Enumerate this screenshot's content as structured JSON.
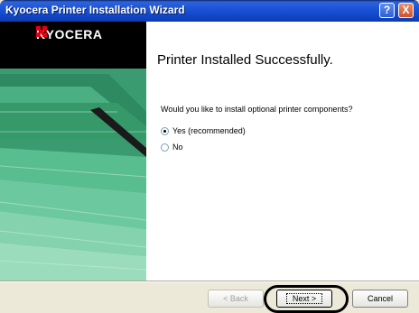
{
  "window": {
    "title": "Kyocera Printer Installation Wizard",
    "help_symbol": "?",
    "close_symbol": "X"
  },
  "sidebar": {
    "brand": "KYOCERA",
    "brand_color": "#e60012",
    "background_color": "#000000",
    "stripe_color": "#3aa57a"
  },
  "content": {
    "heading": "Printer Installed Successfully.",
    "question": "Would you like to install optional printer components?",
    "options": [
      {
        "label": "Yes (recommended)",
        "selected": true
      },
      {
        "label": "No",
        "selected": false
      }
    ]
  },
  "footer": {
    "back_label": "< Back",
    "next_label": "Next >",
    "cancel_label": "Cancel"
  }
}
